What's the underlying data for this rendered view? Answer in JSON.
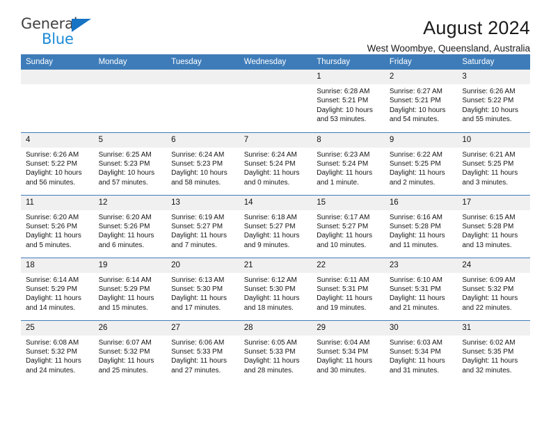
{
  "brand": {
    "name_part1": "General",
    "name_part2": "Blue",
    "triangle_color": "#1773c4",
    "blue_color": "#1b8ad6",
    "gray_color": "#3f3f3f"
  },
  "header": {
    "title": "August 2024",
    "subtitle": "West Woombye, Queensland, Australia"
  },
  "theme": {
    "header_blue": "#3e7cb9",
    "daynum_gray": "#f0f0f0"
  },
  "weekdays": [
    "Sunday",
    "Monday",
    "Tuesday",
    "Wednesday",
    "Thursday",
    "Friday",
    "Saturday"
  ],
  "labels": {
    "sunrise_prefix": "Sunrise:",
    "sunset_prefix": "Sunset:",
    "daylight_prefix": "Daylight:"
  },
  "weeks": [
    [
      {
        "day": "",
        "empty": true
      },
      {
        "day": "",
        "empty": true
      },
      {
        "day": "",
        "empty": true
      },
      {
        "day": "",
        "empty": true
      },
      {
        "day": "1",
        "sunrise": "Sunrise: 6:28 AM",
        "sunset": "Sunset: 5:21 PM",
        "daylight_l1": "Daylight: 10 hours",
        "daylight_l2": "and 53 minutes."
      },
      {
        "day": "2",
        "sunrise": "Sunrise: 6:27 AM",
        "sunset": "Sunset: 5:21 PM",
        "daylight_l1": "Daylight: 10 hours",
        "daylight_l2": "and 54 minutes."
      },
      {
        "day": "3",
        "sunrise": "Sunrise: 6:26 AM",
        "sunset": "Sunset: 5:22 PM",
        "daylight_l1": "Daylight: 10 hours",
        "daylight_l2": "and 55 minutes."
      }
    ],
    [
      {
        "day": "4",
        "sunrise": "Sunrise: 6:26 AM",
        "sunset": "Sunset: 5:22 PM",
        "daylight_l1": "Daylight: 10 hours",
        "daylight_l2": "and 56 minutes."
      },
      {
        "day": "5",
        "sunrise": "Sunrise: 6:25 AM",
        "sunset": "Sunset: 5:23 PM",
        "daylight_l1": "Daylight: 10 hours",
        "daylight_l2": "and 57 minutes."
      },
      {
        "day": "6",
        "sunrise": "Sunrise: 6:24 AM",
        "sunset": "Sunset: 5:23 PM",
        "daylight_l1": "Daylight: 10 hours",
        "daylight_l2": "and 58 minutes."
      },
      {
        "day": "7",
        "sunrise": "Sunrise: 6:24 AM",
        "sunset": "Sunset: 5:24 PM",
        "daylight_l1": "Daylight: 11 hours",
        "daylight_l2": "and 0 minutes."
      },
      {
        "day": "8",
        "sunrise": "Sunrise: 6:23 AM",
        "sunset": "Sunset: 5:24 PM",
        "daylight_l1": "Daylight: 11 hours",
        "daylight_l2": "and 1 minute."
      },
      {
        "day": "9",
        "sunrise": "Sunrise: 6:22 AM",
        "sunset": "Sunset: 5:25 PM",
        "daylight_l1": "Daylight: 11 hours",
        "daylight_l2": "and 2 minutes."
      },
      {
        "day": "10",
        "sunrise": "Sunrise: 6:21 AM",
        "sunset": "Sunset: 5:25 PM",
        "daylight_l1": "Daylight: 11 hours",
        "daylight_l2": "and 3 minutes."
      }
    ],
    [
      {
        "day": "11",
        "sunrise": "Sunrise: 6:20 AM",
        "sunset": "Sunset: 5:26 PM",
        "daylight_l1": "Daylight: 11 hours",
        "daylight_l2": "and 5 minutes."
      },
      {
        "day": "12",
        "sunrise": "Sunrise: 6:20 AM",
        "sunset": "Sunset: 5:26 PM",
        "daylight_l1": "Daylight: 11 hours",
        "daylight_l2": "and 6 minutes."
      },
      {
        "day": "13",
        "sunrise": "Sunrise: 6:19 AM",
        "sunset": "Sunset: 5:27 PM",
        "daylight_l1": "Daylight: 11 hours",
        "daylight_l2": "and 7 minutes."
      },
      {
        "day": "14",
        "sunrise": "Sunrise: 6:18 AM",
        "sunset": "Sunset: 5:27 PM",
        "daylight_l1": "Daylight: 11 hours",
        "daylight_l2": "and 9 minutes."
      },
      {
        "day": "15",
        "sunrise": "Sunrise: 6:17 AM",
        "sunset": "Sunset: 5:27 PM",
        "daylight_l1": "Daylight: 11 hours",
        "daylight_l2": "and 10 minutes."
      },
      {
        "day": "16",
        "sunrise": "Sunrise: 6:16 AM",
        "sunset": "Sunset: 5:28 PM",
        "daylight_l1": "Daylight: 11 hours",
        "daylight_l2": "and 11 minutes."
      },
      {
        "day": "17",
        "sunrise": "Sunrise: 6:15 AM",
        "sunset": "Sunset: 5:28 PM",
        "daylight_l1": "Daylight: 11 hours",
        "daylight_l2": "and 13 minutes."
      }
    ],
    [
      {
        "day": "18",
        "sunrise": "Sunrise: 6:14 AM",
        "sunset": "Sunset: 5:29 PM",
        "daylight_l1": "Daylight: 11 hours",
        "daylight_l2": "and 14 minutes."
      },
      {
        "day": "19",
        "sunrise": "Sunrise: 6:14 AM",
        "sunset": "Sunset: 5:29 PM",
        "daylight_l1": "Daylight: 11 hours",
        "daylight_l2": "and 15 minutes."
      },
      {
        "day": "20",
        "sunrise": "Sunrise: 6:13 AM",
        "sunset": "Sunset: 5:30 PM",
        "daylight_l1": "Daylight: 11 hours",
        "daylight_l2": "and 17 minutes."
      },
      {
        "day": "21",
        "sunrise": "Sunrise: 6:12 AM",
        "sunset": "Sunset: 5:30 PM",
        "daylight_l1": "Daylight: 11 hours",
        "daylight_l2": "and 18 minutes."
      },
      {
        "day": "22",
        "sunrise": "Sunrise: 6:11 AM",
        "sunset": "Sunset: 5:31 PM",
        "daylight_l1": "Daylight: 11 hours",
        "daylight_l2": "and 19 minutes."
      },
      {
        "day": "23",
        "sunrise": "Sunrise: 6:10 AM",
        "sunset": "Sunset: 5:31 PM",
        "daylight_l1": "Daylight: 11 hours",
        "daylight_l2": "and 21 minutes."
      },
      {
        "day": "24",
        "sunrise": "Sunrise: 6:09 AM",
        "sunset": "Sunset: 5:32 PM",
        "daylight_l1": "Daylight: 11 hours",
        "daylight_l2": "and 22 minutes."
      }
    ],
    [
      {
        "day": "25",
        "sunrise": "Sunrise: 6:08 AM",
        "sunset": "Sunset: 5:32 PM",
        "daylight_l1": "Daylight: 11 hours",
        "daylight_l2": "and 24 minutes."
      },
      {
        "day": "26",
        "sunrise": "Sunrise: 6:07 AM",
        "sunset": "Sunset: 5:32 PM",
        "daylight_l1": "Daylight: 11 hours",
        "daylight_l2": "and 25 minutes."
      },
      {
        "day": "27",
        "sunrise": "Sunrise: 6:06 AM",
        "sunset": "Sunset: 5:33 PM",
        "daylight_l1": "Daylight: 11 hours",
        "daylight_l2": "and 27 minutes."
      },
      {
        "day": "28",
        "sunrise": "Sunrise: 6:05 AM",
        "sunset": "Sunset: 5:33 PM",
        "daylight_l1": "Daylight: 11 hours",
        "daylight_l2": "and 28 minutes."
      },
      {
        "day": "29",
        "sunrise": "Sunrise: 6:04 AM",
        "sunset": "Sunset: 5:34 PM",
        "daylight_l1": "Daylight: 11 hours",
        "daylight_l2": "and 30 minutes."
      },
      {
        "day": "30",
        "sunrise": "Sunrise: 6:03 AM",
        "sunset": "Sunset: 5:34 PM",
        "daylight_l1": "Daylight: 11 hours",
        "daylight_l2": "and 31 minutes."
      },
      {
        "day": "31",
        "sunrise": "Sunrise: 6:02 AM",
        "sunset": "Sunset: 5:35 PM",
        "daylight_l1": "Daylight: 11 hours",
        "daylight_l2": "and 32 minutes."
      }
    ]
  ]
}
